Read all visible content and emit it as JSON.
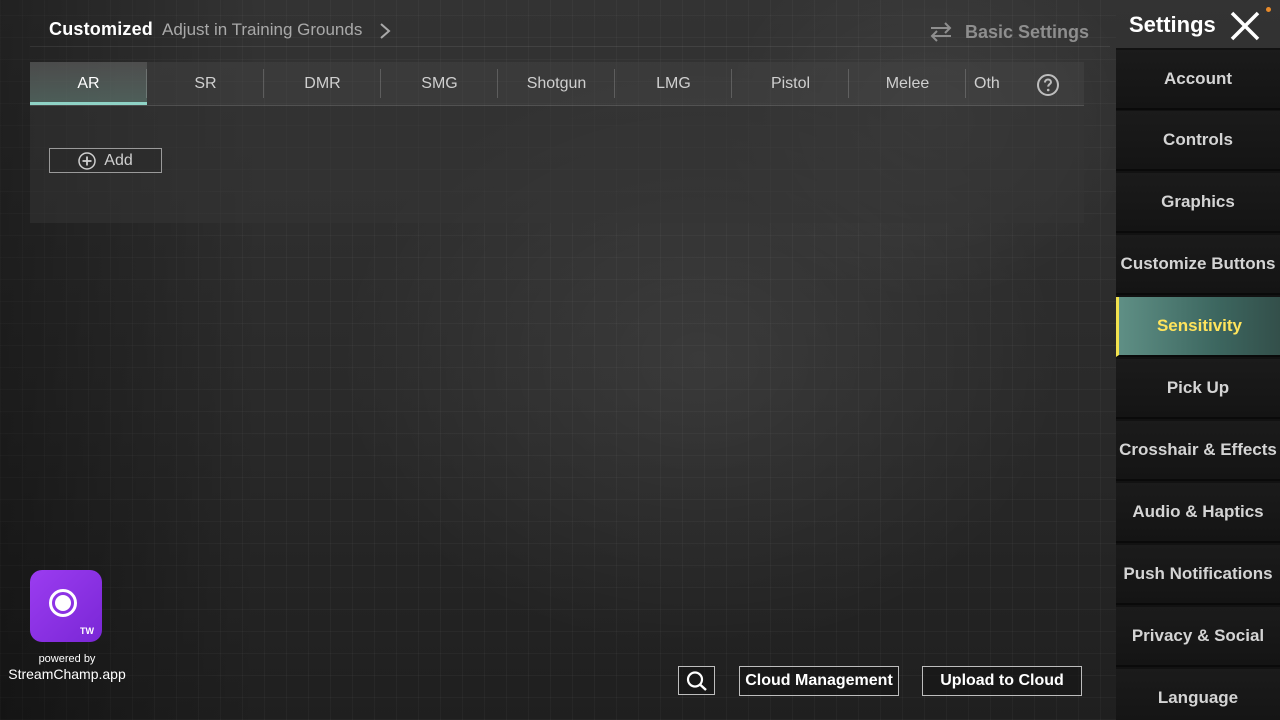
{
  "header": {
    "mode": "Customized",
    "adjust_link": "Adjust in Training Grounds",
    "basic_settings": "Basic Settings",
    "title": "Settings"
  },
  "weapon_tabs": [
    {
      "label": "AR",
      "active": true
    },
    {
      "label": "SR",
      "active": false
    },
    {
      "label": "DMR",
      "active": false
    },
    {
      "label": "SMG",
      "active": false
    },
    {
      "label": "Shotgun",
      "active": false
    },
    {
      "label": "LMG",
      "active": false
    },
    {
      "label": "Pistol",
      "active": false
    },
    {
      "label": "Melee",
      "active": false
    },
    {
      "label": "Oth",
      "active": false
    }
  ],
  "content": {
    "add_label": "Add"
  },
  "sidebar": {
    "items": [
      {
        "label": "Account"
      },
      {
        "label": "Controls"
      },
      {
        "label": "Graphics"
      },
      {
        "label": "Customize Buttons"
      },
      {
        "label": "Sensitivity",
        "active": true
      },
      {
        "label": "Pick Up"
      },
      {
        "label": "Crosshair & Effects"
      },
      {
        "label": "Audio & Haptics"
      },
      {
        "label": "Push Notifications"
      },
      {
        "label": "Privacy & Social"
      },
      {
        "label": "Language"
      }
    ]
  },
  "footer": {
    "cloud_management": "Cloud Management",
    "upload_to_cloud": "Upload to Cloud"
  },
  "watermark": {
    "badge": "TW",
    "powered_by": "powered by",
    "brand": "StreamChamp.app"
  },
  "colors": {
    "active_tab_underline": "#8fd3c6",
    "active_sidebar_text": "#ffe45c",
    "active_sidebar_accent": "#f2e24e",
    "brand_purple": "#8a2fe0"
  },
  "icons": [
    "chevron-right-icon",
    "swap-arrows-icon",
    "close-icon",
    "help-icon",
    "plus-icon",
    "search-icon",
    "streamchamp-logo-icon"
  ]
}
